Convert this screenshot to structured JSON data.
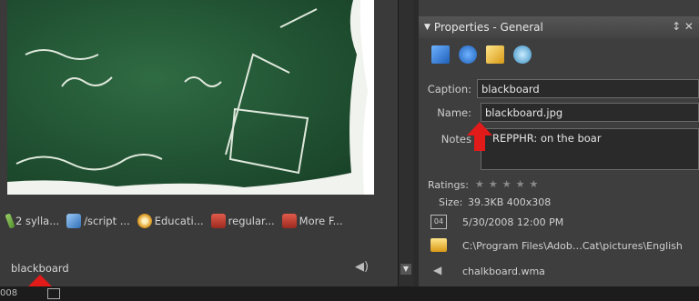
{
  "panel": {
    "title": "Properties - General",
    "controls": "↕ ✕"
  },
  "caption": {
    "label": "Caption:",
    "value": "blackboard"
  },
  "name": {
    "label": "Name:",
    "value": "blackboard.jpg"
  },
  "notes": {
    "label": "Notes",
    "value": "REPPHR: on the boar"
  },
  "ratings": {
    "label": "Ratings:",
    "stars": "★★★★★"
  },
  "size": {
    "label": "Size:",
    "value": "39.3KB  400x308"
  },
  "date": "5/30/2008 12:00 PM",
  "path": "C:\\Program Files\\Adob…Cat\\pictures\\English",
  "audio": "chalkboard.wma",
  "tags": [
    {
      "label": "2 sylla...",
      "icon": "pencil-icon",
      "color": "#7ab648"
    },
    {
      "label": "/script ...",
      "icon": "cube-icon",
      "color": "#4a8fd8"
    },
    {
      "label": "Educati...",
      "icon": "reel-icon",
      "color": "#e0a02c"
    },
    {
      "label": "regular...",
      "icon": "building-icon",
      "color": "#c8463a"
    },
    {
      "label": "More F...",
      "icon": "building-icon",
      "color": "#c8463a"
    }
  ],
  "filename": "blackboard",
  "status": {
    "count": "008"
  },
  "colors": {
    "accent_arrow": "#e11a1a",
    "board": "#1f4f30"
  }
}
